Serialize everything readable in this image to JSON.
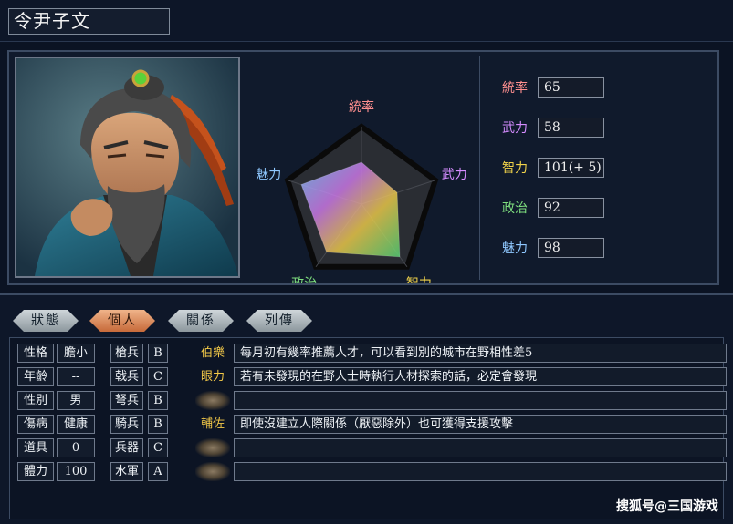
{
  "officer": {
    "name": "令尹子文"
  },
  "radar": {
    "labels": {
      "leadership": "統率",
      "war": "武力",
      "intelligence": "智力",
      "politics": "政治",
      "charisma": "魅力"
    },
    "colors": {
      "leadership": "#ff8f8f",
      "war": "#d58cff",
      "intelligence": "#f1d34a",
      "politics": "#7fe07f",
      "charisma": "#8fc8ff"
    }
  },
  "stats": [
    {
      "label": "統率",
      "value": "65",
      "color": "#ff8f8f"
    },
    {
      "label": "武力",
      "value": "58",
      "color": "#d58cff"
    },
    {
      "label": "智力",
      "value": "101(+ 5)",
      "color": "#f1d34a"
    },
    {
      "label": "政治",
      "value": "92",
      "color": "#7fe07f"
    },
    {
      "label": "魅力",
      "value": "98",
      "color": "#8fc8ff"
    }
  ],
  "tabs": [
    {
      "label": "狀態",
      "active": false
    },
    {
      "label": "個人",
      "active": true
    },
    {
      "label": "關係",
      "active": false
    },
    {
      "label": "列傳",
      "active": false
    }
  ],
  "attributes": [
    {
      "label": "性格",
      "value": "膽小"
    },
    {
      "label": "年齡",
      "value": "--"
    },
    {
      "label": "性別",
      "value": "男"
    },
    {
      "label": "傷病",
      "value": "健康"
    },
    {
      "label": "道具",
      "value": "0"
    },
    {
      "label": "體力",
      "value": "100"
    }
  ],
  "aptitudes": [
    {
      "label": "槍兵",
      "grade": "B"
    },
    {
      "label": "戟兵",
      "grade": "C"
    },
    {
      "label": "弩兵",
      "grade": "B"
    },
    {
      "label": "騎兵",
      "grade": "B"
    },
    {
      "label": "兵器",
      "grade": "C"
    },
    {
      "label": "水軍",
      "grade": "A"
    }
  ],
  "skills": [
    {
      "name": "伯樂",
      "desc": "每月初有幾率推薦人才，可以看到別的城市在野相性差5"
    },
    {
      "name": "眼力",
      "desc": "若有未發現的在野人士時執行人材探索的話，必定會發現"
    },
    {
      "name": "",
      "desc": ""
    },
    {
      "name": "輔佐",
      "desc": "即使沒建立人際關係（厭惡除外）也可獲得支援攻擊"
    },
    {
      "name": "",
      "desc": ""
    },
    {
      "name": "",
      "desc": ""
    }
  ],
  "watermark": "搜狐号@三国游戏"
}
